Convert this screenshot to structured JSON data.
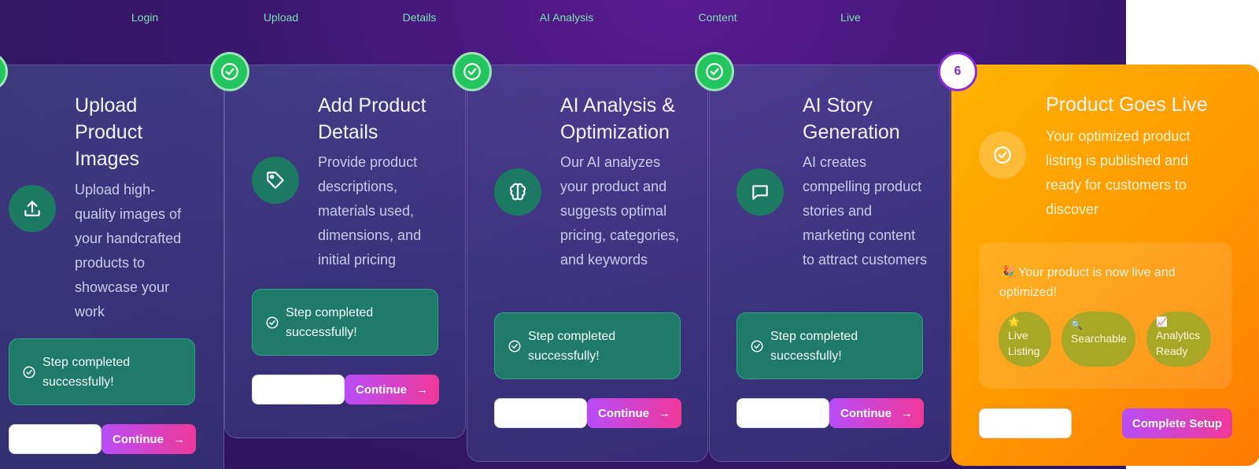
{
  "steps_nav": [
    "Login",
    "Upload",
    "Details",
    "AI Analysis",
    "Content",
    "Live"
  ],
  "cards": [
    {
      "title_lines": [
        "Upload",
        "Product",
        "Images"
      ],
      "description": "Upload high-quality images of your handcrafted products to showcase your work",
      "icon": "upload-icon",
      "success_text": "Step completed successfully!",
      "continue_label": "Continue"
    },
    {
      "title_lines": [
        "Add Product",
        "Details"
      ],
      "description": "Provide product descriptions, materials used, dimensions, and initial pricing",
      "icon": "tag-icon",
      "success_text": "Step completed successfully!",
      "continue_label": "Continue"
    },
    {
      "title_lines": [
        "AI Analysis &",
        "Optimization"
      ],
      "description": "Our AI analyzes your product and suggests optimal pricing, categories, and keywords",
      "icon": "brain-icon",
      "success_text": "Step completed successfully!",
      "continue_label": "Continue"
    },
    {
      "title_lines": [
        "AI Story",
        "Generation"
      ],
      "description": "AI creates compelling product stories and marketing content to attract customers",
      "icon": "message-icon",
      "success_text": "Step completed successfully!",
      "continue_label": "Continue"
    }
  ],
  "final_card": {
    "step_number": "6",
    "title": "Product Goes Live",
    "description": "Your optimized product listing is published and ready for customers to discover",
    "icon": "check-circle-icon",
    "live_message": "🎉 Your product is now live and optimized!",
    "pills": [
      {
        "emoji": "🌟",
        "label": "Live Listing"
      },
      {
        "emoji": "🔍",
        "label": "Searchable"
      },
      {
        "emoji": "📈",
        "label": "Analytics Ready"
      }
    ],
    "complete_label": "Complete Setup"
  },
  "colors": {
    "background": "#3a176e",
    "card": "#3f4a8a",
    "success_badge": "#22c55e",
    "icon_circle": "#1c7a62",
    "success_box": "#1f7a6a",
    "final_card": "#ff9800",
    "accent_gradient_start": "#b84df7",
    "accent_gradient_end": "#f0389a",
    "nav_text": "#7be0b4"
  }
}
